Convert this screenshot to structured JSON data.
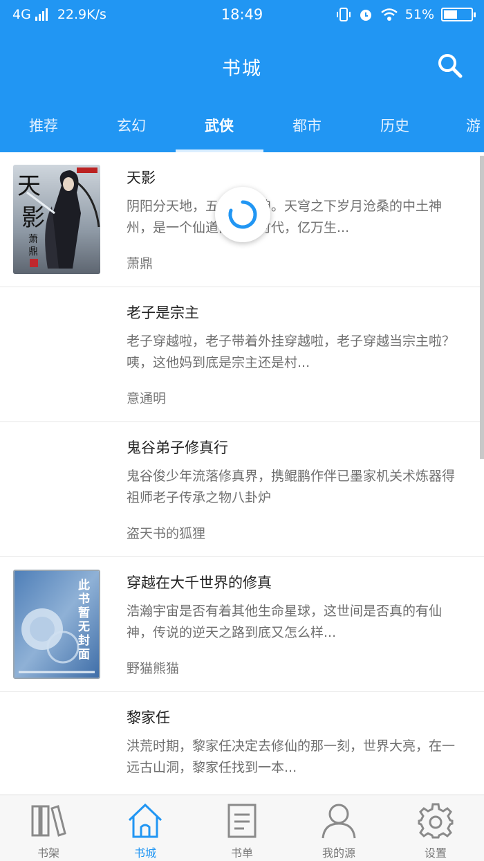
{
  "status_bar": {
    "network": "4G",
    "speed": "22.9K/s",
    "time": "18:49",
    "battery": "51%"
  },
  "header": {
    "title": "书城",
    "search_icon": "search-icon"
  },
  "tabs": [
    {
      "label": "推荐",
      "active": false
    },
    {
      "label": "玄幻",
      "active": false
    },
    {
      "label": "武侠",
      "active": true
    },
    {
      "label": "都市",
      "active": false
    },
    {
      "label": "历史",
      "active": false
    },
    {
      "label": "游",
      "active": false
    }
  ],
  "books": [
    {
      "title": "天影",
      "description": "阴阳分天地，五行定乾坤。天穹之下岁月沧桑的中土神州，是一个仙道昌盛的时代，亿万生...",
      "author": "萧鼎",
      "cover": {
        "type": "image",
        "lettering": "天影 萧鼎"
      }
    },
    {
      "title": "老子是宗主",
      "description": "老子穿越啦，老子带着外挂穿越啦，老子穿越当宗主啦？咦，这他妈到底是宗主还是村...",
      "author": "意通明",
      "cover": null
    },
    {
      "title": "鬼谷弟子修真行",
      "description": "鬼谷俊少年流落修真界，携鲲鹏作伴已墨家机关术炼器得祖师老子传承之物八卦炉",
      "author": "盗天书的狐狸",
      "cover": null
    },
    {
      "title": "穿越在大千世界的修真",
      "description": "浩瀚宇宙是否有着其他生命星球，这世间是否真的有仙神，传说的逆天之路到底又怎么样...",
      "author": "野猫熊猫",
      "cover": {
        "type": "placeholder",
        "lettering": "此书暂无封面"
      }
    },
    {
      "title": "黎家任",
      "description": "洪荒时期，黎家任决定去修仙的那一刻，世界大亮，在一远古山洞，黎家任找到一本...",
      "author": "",
      "cover": null
    }
  ],
  "bottom_nav": [
    {
      "label": "书架",
      "icon": "bookshelf-icon",
      "active": false
    },
    {
      "label": "书城",
      "icon": "home-icon",
      "active": true
    },
    {
      "label": "书单",
      "icon": "booklist-icon",
      "active": false
    },
    {
      "label": "我的源",
      "icon": "user-icon",
      "active": false
    },
    {
      "label": "设置",
      "icon": "gear-icon",
      "active": false
    }
  ],
  "colors": {
    "primary": "#2196f3",
    "active_nav": "#2196f3",
    "inactive_nav": "#777777"
  },
  "loading": true
}
